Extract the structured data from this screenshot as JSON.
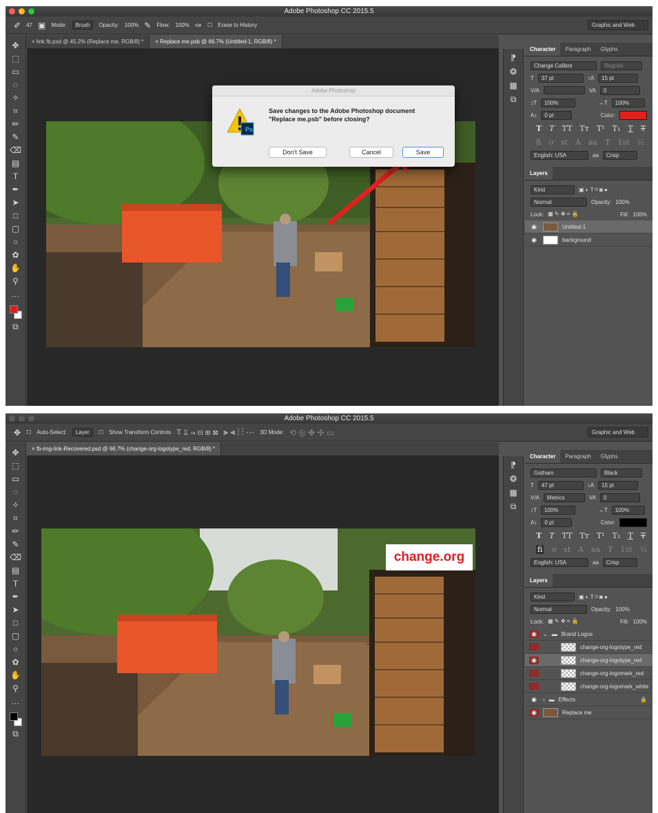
{
  "s1": {
    "title": "Adobe Photoshop CC 2015.5",
    "options": {
      "brush_size": "47",
      "mode_label": "Mode:",
      "mode_value": "Brush",
      "opacity_label": "Opacity:",
      "opacity_value": "100%",
      "flow_label": "Flow:",
      "flow_value": "100%",
      "erase_history": "Erase to History"
    },
    "workspace": "Graphic and Web",
    "tabs": [
      "link fb.psd @ 45.2% (Replace me, RGB/8) *",
      "Replace me.psb @ 66.7% (Untitled-1, RGB/8) *"
    ],
    "dialog": {
      "title": "Adobe Photoshop",
      "message_line1": "Save changes to the Adobe Photoshop document",
      "message_line2": "\"Replace me.psb\" before closing?",
      "dont_save": "Don't Save",
      "cancel": "Cancel",
      "save": "Save",
      "badge": "Ps"
    },
    "character": {
      "tabs": [
        "Character",
        "Paragraph",
        "Glyphs"
      ],
      "font": "Change Calibre",
      "style": "Regular",
      "size": "37 pt",
      "leading": "15 pt",
      "kerning": "",
      "tracking": "0",
      "vscale": "100%",
      "hscale": "100%",
      "baseline": "0 pt",
      "color_label": "Color:",
      "color": "#e0201c",
      "language": "English: USA",
      "aa_label": "aa",
      "aa": "Crisp"
    },
    "layers": {
      "tab": "Layers",
      "kind": "Kind",
      "blend": "Normal",
      "opacity_label": "Opacity:",
      "opacity": "100%",
      "lock_label": "Lock:",
      "fill_label": "Fill:",
      "fill": "100%",
      "items": [
        "Untitled-1",
        "background"
      ]
    }
  },
  "s2": {
    "title": "Adobe Photoshop CC 2015.5",
    "options": {
      "auto_select": "Auto-Select:",
      "layer": "Layer",
      "transform": "Show Transform Controls",
      "mode3d": "3D Mode:"
    },
    "workspace": "Graphic and Web",
    "tabs": [
      "fb-img-link-Recovered.psd @ 66.7% (change-org-logotype_red, RGB/8) *"
    ],
    "logo": "change.org",
    "character": {
      "tabs": [
        "Character",
        "Paragraph",
        "Glyphs"
      ],
      "font": "Gotham",
      "style": "Black",
      "size": "47 pt",
      "leading": "15 pt",
      "kerning": "Metrics",
      "tracking": "0",
      "vscale": "100%",
      "hscale": "100%",
      "baseline": "0 pt",
      "color_label": "Color:",
      "color": "#000000",
      "language": "English: USA",
      "aa_label": "aa",
      "aa": "Crisp"
    },
    "layers": {
      "tab": "Layers",
      "kind": "Kind",
      "blend": "Normal",
      "opacity_label": "Opacity:",
      "opacity": "100%",
      "lock_label": "Lock:",
      "fill_label": "Fill:",
      "fill": "100%",
      "group": "Brand Logos",
      "items": [
        "change-org-logotype_red",
        "change-org-logotype_red",
        "change-org-logomark_red",
        "change-org-logomark_white"
      ],
      "effects": "Effects",
      "replace": "Replace me"
    }
  },
  "colors": {
    "accent_red": "#e0201c",
    "brand_red": "#e21c24"
  }
}
